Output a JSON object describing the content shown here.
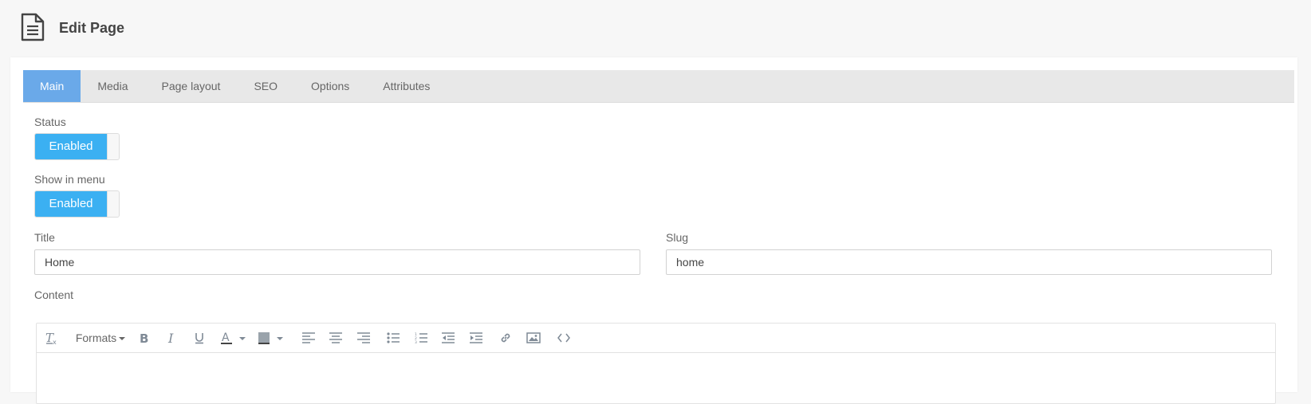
{
  "header": {
    "title": "Edit Page",
    "icon": "document-icon"
  },
  "tabs": [
    {
      "label": "Main",
      "active": true
    },
    {
      "label": "Media",
      "active": false
    },
    {
      "label": "Page layout",
      "active": false
    },
    {
      "label": "SEO",
      "active": false
    },
    {
      "label": "Options",
      "active": false
    },
    {
      "label": "Attributes",
      "active": false
    }
  ],
  "form": {
    "status": {
      "label": "Status",
      "value": "Enabled"
    },
    "show_in_menu": {
      "label": "Show in menu",
      "value": "Enabled"
    },
    "title": {
      "label": "Title",
      "value": "Home"
    },
    "slug": {
      "label": "Slug",
      "value": "home"
    },
    "content": {
      "label": "Content"
    }
  },
  "editor_toolbar": {
    "formats_label": "Formats",
    "buttons": [
      "clear-formatting-icon",
      "bold-icon",
      "italic-icon",
      "underline-icon",
      "text-color-icon",
      "background-color-icon",
      "align-left-icon",
      "align-center-icon",
      "align-right-icon",
      "bullet-list-icon",
      "numbered-list-icon",
      "outdent-icon",
      "indent-icon",
      "link-icon",
      "image-icon",
      "source-code-icon"
    ]
  },
  "colors": {
    "active_tab": "#6aa9e9",
    "toggle_on": "#3bb0f2",
    "tab_bar": "#e8e8e8"
  }
}
